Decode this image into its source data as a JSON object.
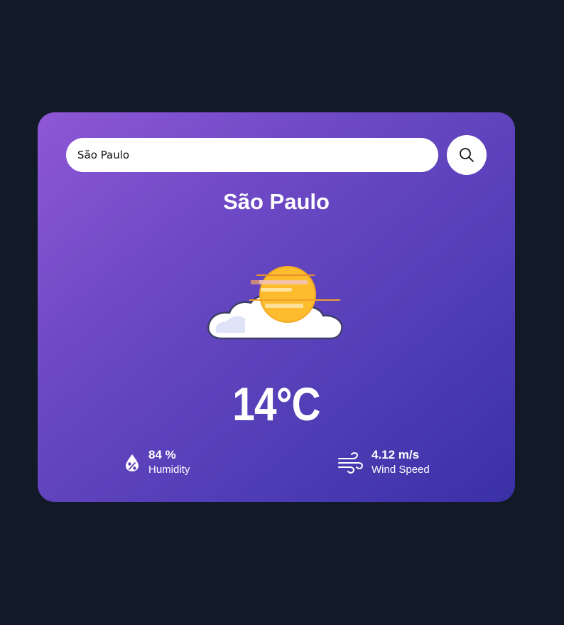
{
  "search": {
    "value": "São Paulo",
    "button_icon": "search-icon"
  },
  "weather": {
    "city": "São Paulo",
    "icon": "mist-sun-cloud-icon",
    "temperature": "14°C"
  },
  "details": {
    "humidity": {
      "icon": "humidity-drop-icon",
      "value": "84 %",
      "label": "Humidity"
    },
    "wind": {
      "icon": "wind-icon",
      "value": "4.12 m/s",
      "label": "Wind Speed"
    }
  },
  "colors": {
    "page_background": "#131a27",
    "card_gradient_start": "#8e57d6",
    "card_gradient_end": "#3a30a6",
    "sun": "#fcbc2d",
    "cloud": "#ffffff"
  }
}
